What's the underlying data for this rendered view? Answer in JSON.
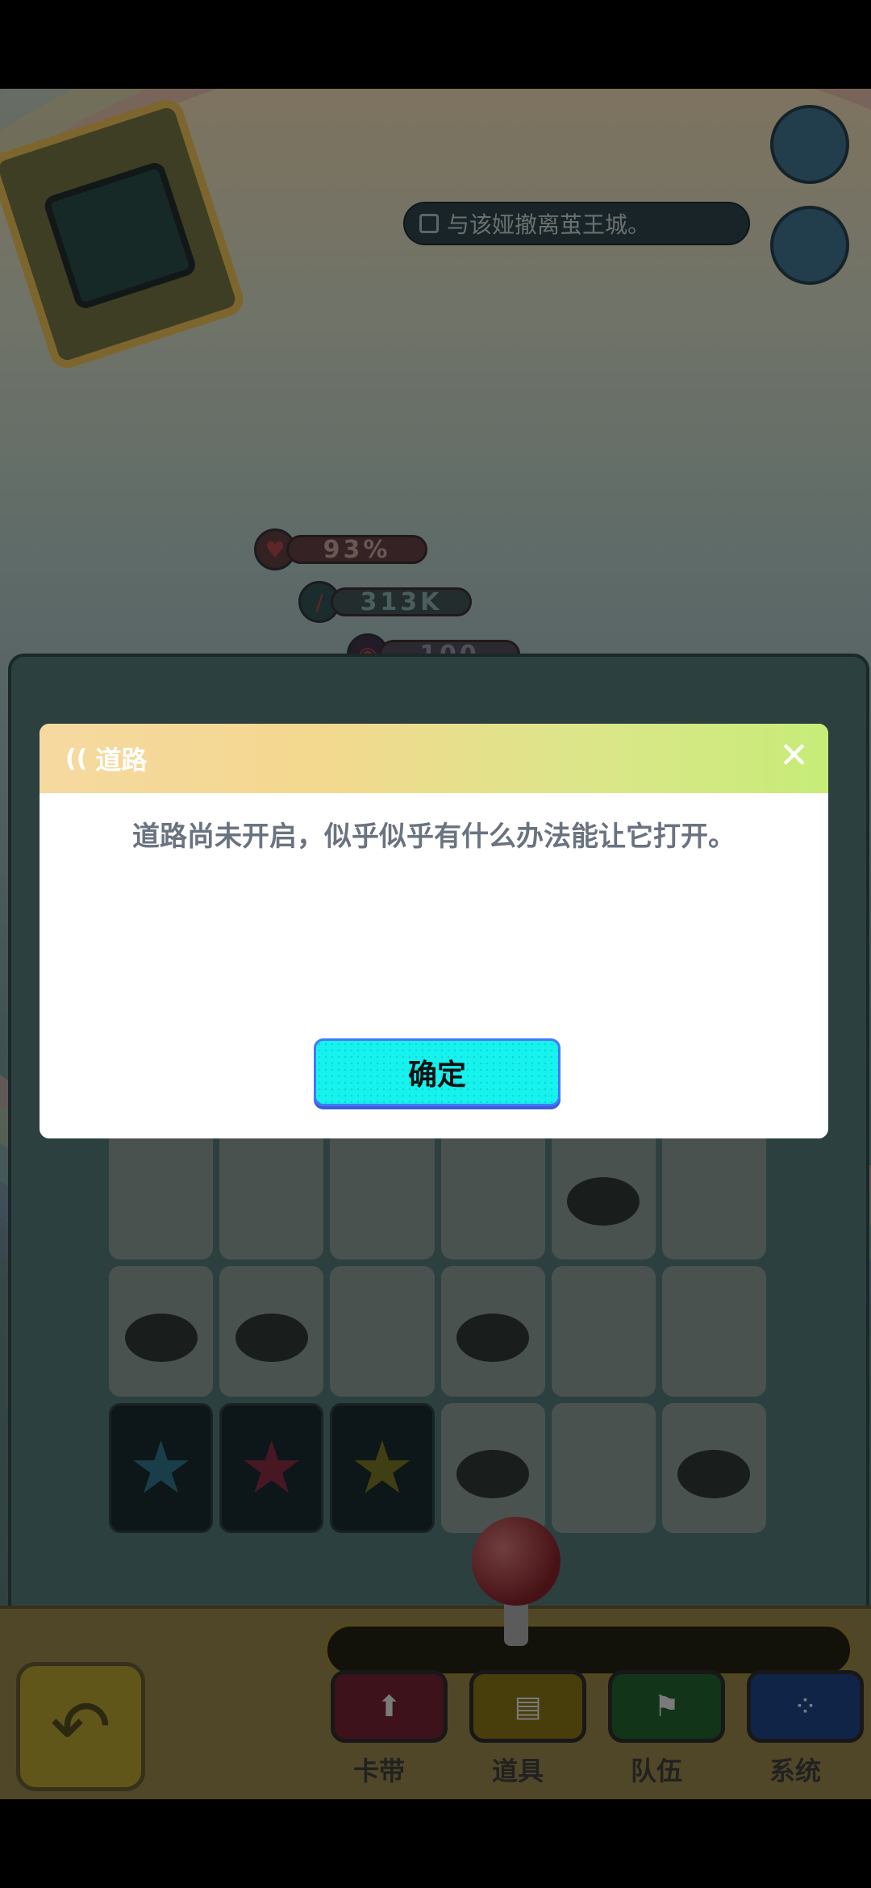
{
  "hud": {
    "quest_text": "与该娅撤离茧王城。",
    "health": "93%",
    "attack": "313K",
    "shield": "100"
  },
  "dialog": {
    "title": "道路",
    "message": "道路尚未开启，似乎似乎有什么办法能让它打开。",
    "confirm_label": "确定",
    "close_glyph": "✕"
  },
  "menu": {
    "items": [
      {
        "label": "卡带",
        "icon": "⬆",
        "color": "#6a2030"
      },
      {
        "label": "道具",
        "icon": "▤",
        "color": "#7d6b14"
      },
      {
        "label": "队伍",
        "icon": "⚑",
        "color": "#1f5a2c"
      },
      {
        "label": "系统",
        "icon": "⁘",
        "color": "#1d3f7c"
      }
    ]
  },
  "board": {
    "stars": [
      "#2e6b7f",
      "#7a2a3f",
      "#6f6b22"
    ]
  },
  "colors": {
    "confirm_button": "#16f2ee",
    "header_gradient_start": "#f6d9a0",
    "header_gradient_end": "#c7ec78"
  }
}
